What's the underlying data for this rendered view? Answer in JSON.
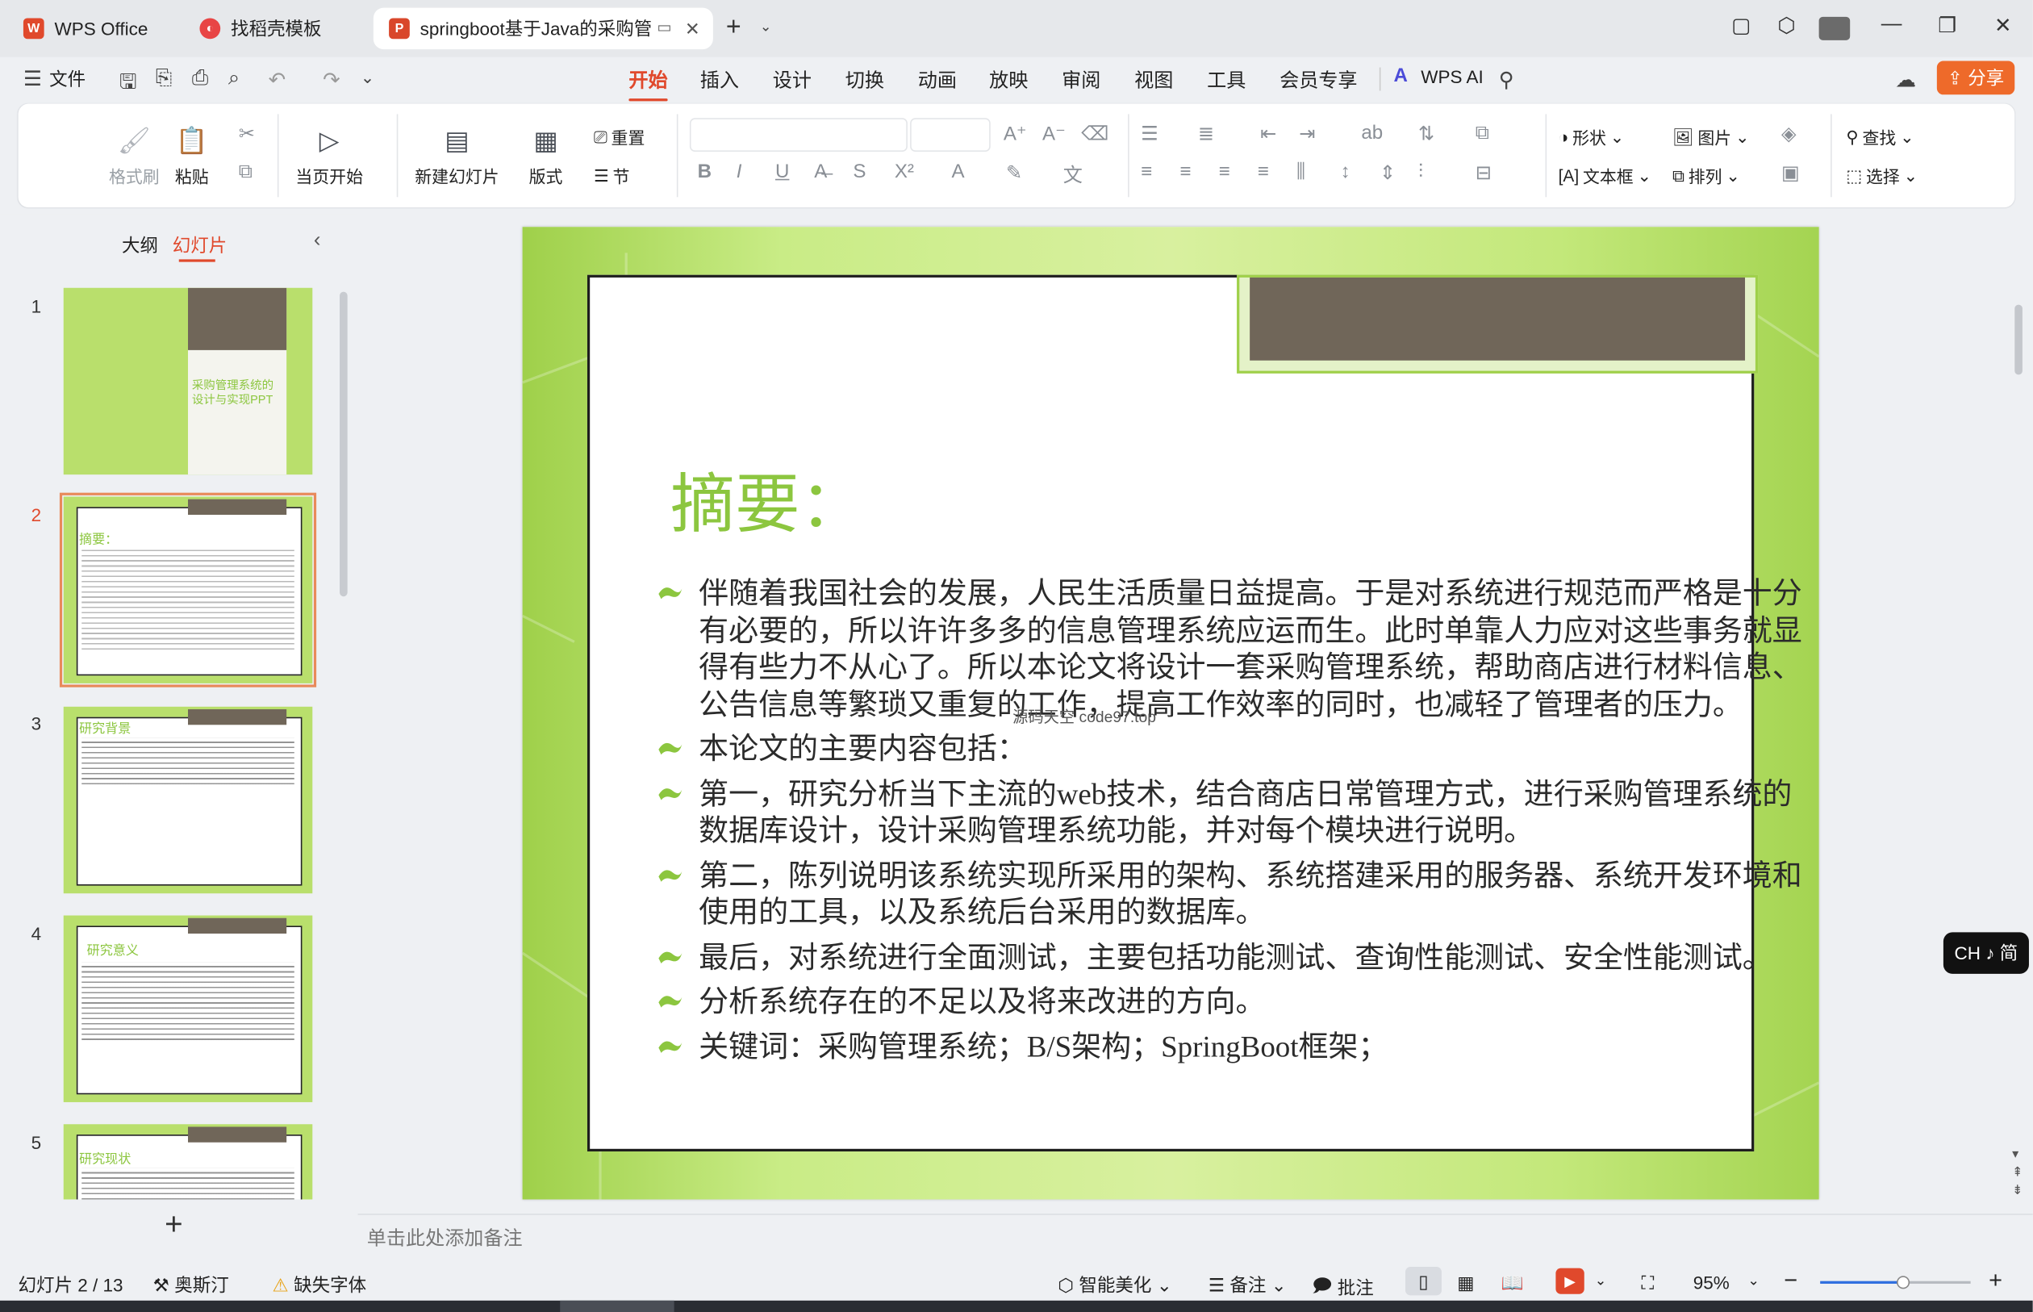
{
  "tabs": [
    {
      "label": "WPS Office",
      "icon": "wps-logo-icon"
    },
    {
      "label": "找稻壳模板",
      "icon": "docer-icon"
    },
    {
      "label": "springboot基于Java的采购管",
      "icon": "presentation-icon"
    }
  ],
  "menu": {
    "file_label": "文件",
    "tabs": [
      "开始",
      "插入",
      "设计",
      "切换",
      "动画",
      "放映",
      "审阅",
      "视图",
      "工具",
      "会员专享"
    ],
    "active_tab": "开始",
    "wps_ai": "WPS AI",
    "share": "分享"
  },
  "ribbon": {
    "format_painter": "格式刷",
    "paste": "粘贴",
    "play_from_current": "当页开始",
    "new_slide": "新建幻灯片",
    "layout": "版式",
    "reset": "重置",
    "section": "节",
    "shape": "形状",
    "picture": "图片",
    "textbox": "文本框",
    "arrange": "排列",
    "find": "查找",
    "select": "选择"
  },
  "panel": {
    "outline_tab": "大纲",
    "slides_tab": "幻灯片",
    "thumbnails": [
      {
        "num": "1",
        "title": "采购管理系统的设计与实现PPT"
      },
      {
        "num": "2",
        "title": "摘要："
      },
      {
        "num": "3",
        "title": "研究背景"
      },
      {
        "num": "4",
        "title": "研究意义"
      },
      {
        "num": "5",
        "title": "研究现状"
      }
    ],
    "add_label": "+"
  },
  "slide": {
    "title": "摘要：",
    "bullets": [
      " 伴随着我国社会的发展，人民生活质量日益提高。于是对系统进行规范而严格是十分有必要的，所以许许多多的信息管理系统应运而生。此时单靠人力应对这些事务就显得有些力不从心了。所以本论文将设计一套采购管理系统，帮助商店进行材料信息、公告信息等繁琐又重复的工作，提高工作效率的同时，也减轻了管理者的压力。",
      "本论文的主要内容包括：",
      "第一，研究分析当下主流的web技术，结合商店日常管理方式，进行采购管理系统的数据库设计，设计采购管理系统功能，并对每个模块进行说明。",
      "第二，陈列说明该系统实现所采用的架构、系统搭建采用的服务器、系统开发环境和使用的工具，以及系统后台采用的数据库。",
      "最后，对系统进行全面测试，主要包括功能测试、查询性能测试、安全性能测试。",
      "分析系统存在的不足以及将来改进的方向。",
      "关键词：采购管理系统；B/S架构；SpringBoot框架；"
    ],
    "watermark": "源码天空 code97.top"
  },
  "notes_placeholder": "单击此处添加备注",
  "status": {
    "slide_counter": "幻灯片 2 / 13",
    "theme": "奥斯汀",
    "missing_font": "缺失字体",
    "smart_beautify": "智能美化",
    "notes": "备注",
    "comments": "批注",
    "zoom": "95%",
    "zoom_fraction": 0.55
  },
  "ime": "CH ♪ 简",
  "colors": {
    "accent": "#e0492c",
    "slide_green": "#8cc63f",
    "title_block": "#706659"
  }
}
